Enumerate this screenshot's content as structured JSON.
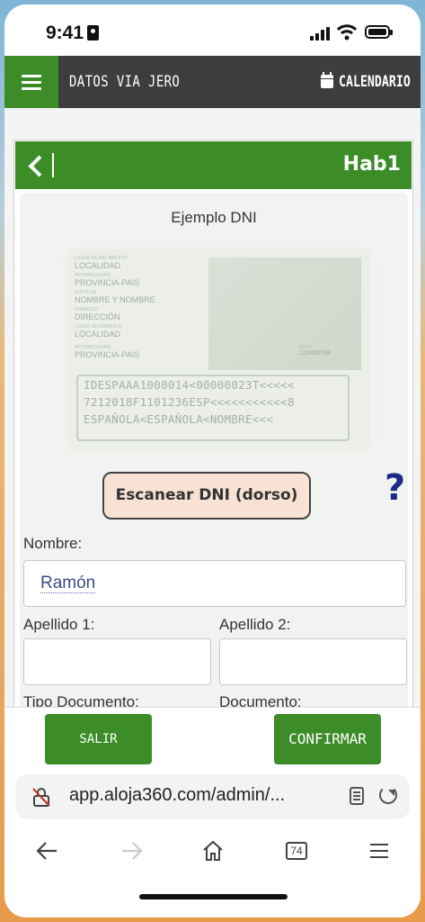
{
  "status_bar": {
    "time": "9:41"
  },
  "app_bar": {
    "title": "DATOS VIA JERO",
    "calendar_label": "CALENDARIO"
  },
  "card": {
    "room_label": "Hab1"
  },
  "dni_example": {
    "title": "Ejemplo DNI",
    "fields": [
      {
        "caption": "LUGAR DE NACIMIENTO",
        "value": "LOCALIDAD"
      },
      {
        "caption": "PROVINCIA-PAÍS",
        "value": "PROVINCIA-PAIS"
      },
      {
        "caption": "HIJO/A DE",
        "value": "NOMBRE Y NOMBRE"
      },
      {
        "caption": "DOMICILIO",
        "value": "DIRECCIÓN"
      },
      {
        "caption": "LUGAR DE DOMICILIO",
        "value": "LOCALIDAD"
      },
      {
        "caption": "PROVINCIA-PAÍS",
        "value": "PROVINCIA-PAIS"
      }
    ],
    "number_caption": "IDESP",
    "number_value": "123456789",
    "mrz": [
      "IDESPAAA1000014<00000023T<<<<<",
      "7212018F1101236ESP<<<<<<<<<<<8",
      "ESPAÑOLA<ESPAÑOLA<NOMBRE<<<"
    ]
  },
  "scan_button": {
    "label": "Escanear DNI (dorso)"
  },
  "help": {
    "label": "?"
  },
  "form": {
    "nombre_label": "Nombre:",
    "nombre_value": "Ramón",
    "apellido1_label": "Apellido 1:",
    "apellido1_value": "",
    "apellido2_label": "Apellido 2:",
    "apellido2_value": "",
    "tipo_documento_label": "Tipo Documento:",
    "documento_label": "Documento:"
  },
  "actions": {
    "exit_label": "SALIR",
    "confirm_label": "CONFIRMAR"
  },
  "browser": {
    "url": "app.aloja360.com/admin/...",
    "tab_count": "74"
  },
  "colors": {
    "brand_green": "#3c8c28",
    "header_dark": "#3d3d3d",
    "help_blue": "#1d2a8a",
    "scan_button_bg": "#f7e2d3"
  }
}
